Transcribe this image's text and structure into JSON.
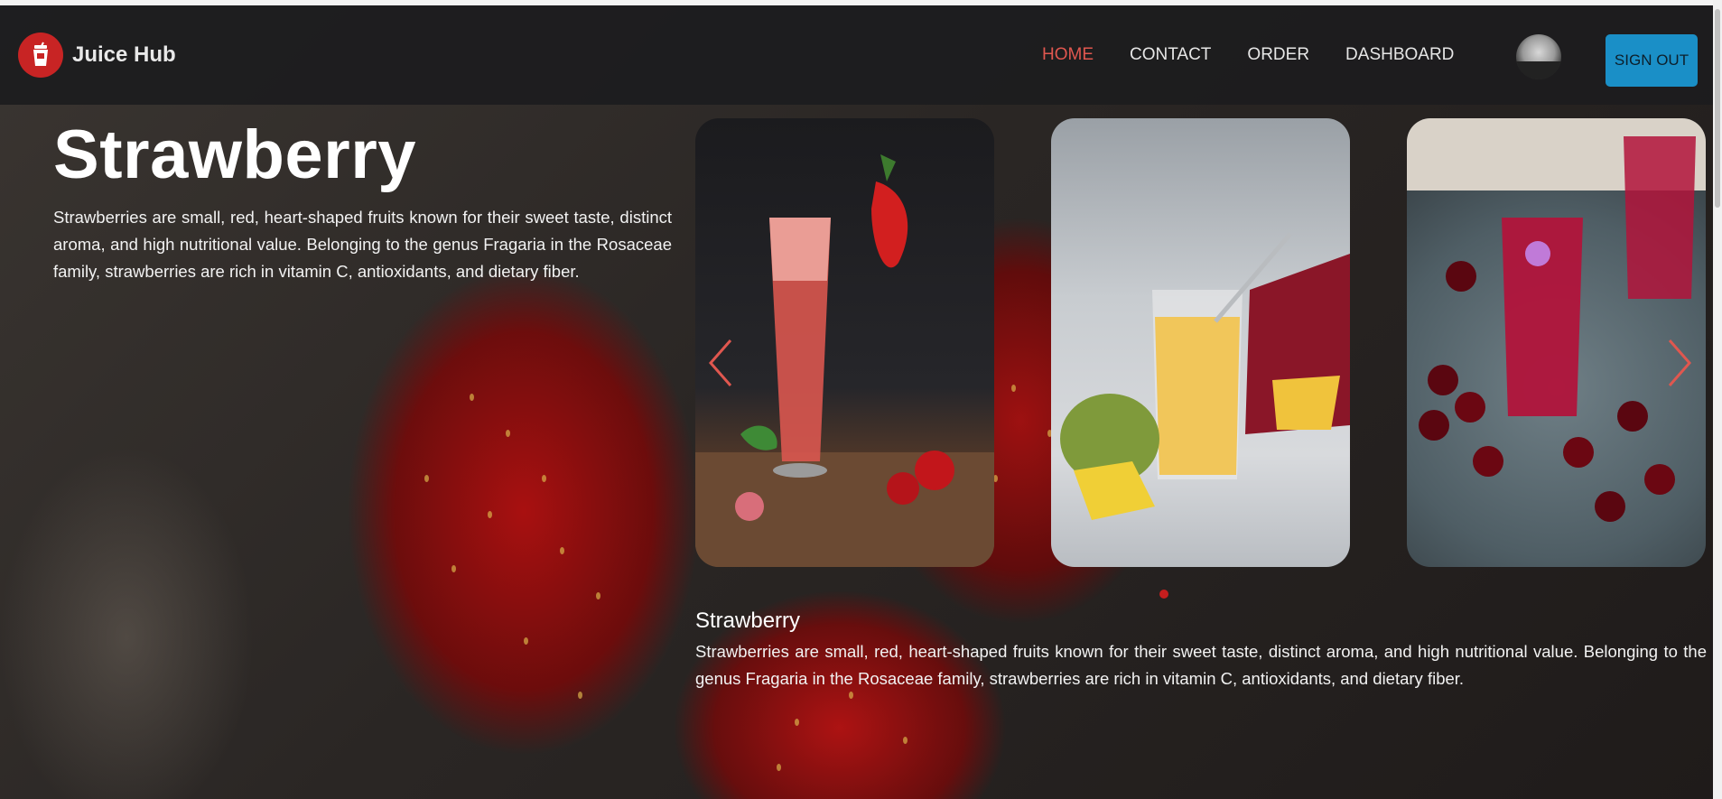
{
  "brand": {
    "name": "Juice Hub",
    "logo_icon": "juice-cup-icon",
    "logo_color": "#c82424"
  },
  "nav": {
    "items": [
      {
        "label": "HOME",
        "active": true
      },
      {
        "label": "CONTACT",
        "active": false
      },
      {
        "label": "ORDER",
        "active": false
      },
      {
        "label": "DASHBOARD",
        "active": false
      }
    ],
    "active_color": "#e0574f",
    "signout_label": "SIGN OUT",
    "signout_color": "#1a8fc7"
  },
  "hero": {
    "title": "Strawberry",
    "description": "Strawberries are small, red, heart-shaped fruits known for their sweet taste, distinct aroma, and high nutritional value. Belonging to the genus Fragaria in the Rosaceae family, strawberries are rich in vitamin C, antioxidants, and dietary fiber."
  },
  "carousel": {
    "slides": [
      {
        "image": "strawberry-iced-drink"
      },
      {
        "image": "mango-smoothie"
      },
      {
        "image": "cherry-juice"
      }
    ],
    "prev_icon": "chevron-left-icon",
    "next_icon": "chevron-right-icon",
    "arrow_color": "#e0574f",
    "active_dot_color": "#c41e1e",
    "caption": {
      "title": "Strawberry",
      "description": "Strawberries are small, red, heart-shaped fruits known for their sweet taste, distinct aroma, and high nutritional value. Belonging to the genus Fragaria in the Rosaceae family, strawberries are rich in vitamin C, antioxidants, and dietary fiber."
    }
  }
}
